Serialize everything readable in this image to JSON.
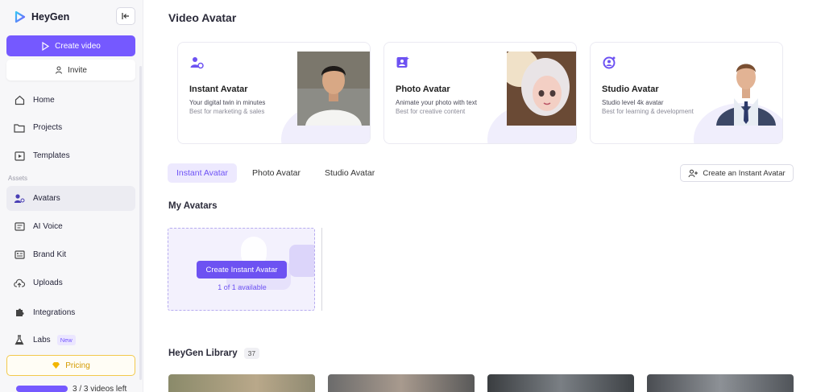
{
  "app": {
    "name": "HeyGen",
    "brand_color": "#7559ff"
  },
  "sidebar": {
    "create_label": "Create video",
    "invite_label": "Invite",
    "items": [
      {
        "label": "Home",
        "icon": "home-icon"
      },
      {
        "label": "Projects",
        "icon": "folder-icon"
      },
      {
        "label": "Templates",
        "icon": "templates-icon"
      }
    ],
    "section_label": "Assets",
    "asset_items": [
      {
        "label": "Avatars",
        "icon": "avatar-icon",
        "active": true
      },
      {
        "label": "AI Voice",
        "icon": "voice-icon"
      },
      {
        "label": "Brand Kit",
        "icon": "brand-kit-icon"
      },
      {
        "label": "Uploads",
        "icon": "upload-icon"
      },
      {
        "label": "Integrations",
        "icon": "puzzle-icon"
      },
      {
        "label": "Labs",
        "icon": "flask-icon",
        "badge": "New"
      }
    ],
    "pricing_label": "Pricing",
    "usage_text": "3 / 3 videos left"
  },
  "main": {
    "title": "Video Avatar",
    "cards": [
      {
        "title": "Instant Avatar",
        "desc": "Your digital twin in minutes",
        "sub": "Best for marketing & sales"
      },
      {
        "title": "Photo Avatar",
        "desc": "Animate your photo with text",
        "sub": "Best for creative content"
      },
      {
        "title": "Studio Avatar",
        "desc": "Studio level 4k avatar",
        "sub": "Best for learning & development"
      }
    ],
    "tabs": [
      "Instant Avatar",
      "Photo Avatar",
      "Studio Avatar"
    ],
    "create_instant_label": "Create an Instant Avatar",
    "my_avatars_title": "My Avatars",
    "tile_button": "Create Instant Avatar",
    "tile_available": "1 of 1 available",
    "library_title": "HeyGen Library",
    "library_count": "37"
  }
}
